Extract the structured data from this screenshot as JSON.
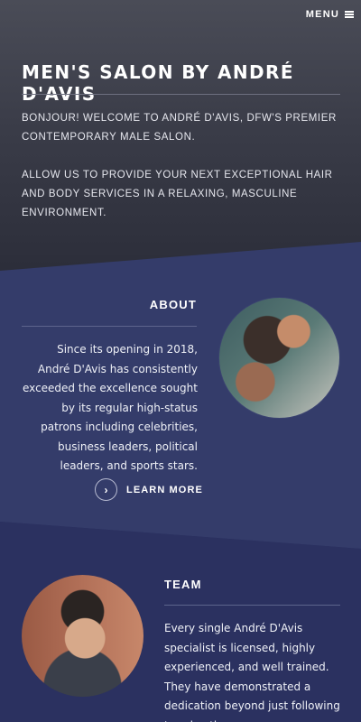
{
  "header": {
    "menu_label": "MENU",
    "menu_icon": "hamburger-icon"
  },
  "hero": {
    "title": "MEN'S SALON BY ANDRÉ D'AVIS",
    "paragraph1": "BONJOUR! WELCOME TO ANDRÉ D'AVIS, DFW'S PREMIER CONTEMPORARY MALE SALON.",
    "paragraph2": "ALLOW US TO PROVIDE YOUR NEXT EXCEPTIONAL HAIR AND BODY SERVICES IN A RELAXING, MASCULINE ENVIRONMENT."
  },
  "about": {
    "heading": "ABOUT",
    "text": "Since its opening in 2018, André D'Avis has consistently exceeded the excellence sought by its regular high-status patrons including celebrities, business leaders, political leaders, and sports stars.",
    "learn_more": "LEARN MORE",
    "learn_more_icon": "chevron-right-icon"
  },
  "team": {
    "heading": "TEAM",
    "text": "Every single André D'Avis specialist is licensed, highly experienced, and well trained. They have demonstrated a dedication beyond just following trends - they are"
  },
  "colors": {
    "hero_top": "#4a4c57",
    "band": "#343c6a",
    "background": "#2b3060"
  }
}
